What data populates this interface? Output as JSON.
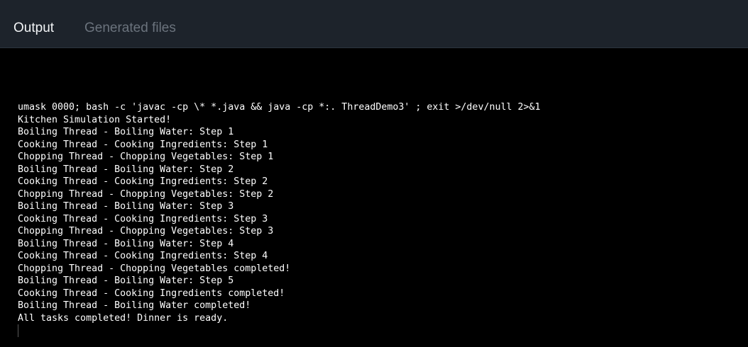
{
  "tabs": {
    "output": "Output",
    "generated_files": "Generated files"
  },
  "terminal": {
    "lines": [
      "umask 0000; bash -c 'javac -cp \\* *.java && java -cp *:. ThreadDemo3' ; exit >/dev/null 2>&1",
      "Kitchen Simulation Started!",
      "Boiling Thread - Boiling Water: Step 1",
      "Cooking Thread - Cooking Ingredients: Step 1",
      "Chopping Thread - Chopping Vegetables: Step 1",
      "Boiling Thread - Boiling Water: Step 2",
      "Cooking Thread - Cooking Ingredients: Step 2",
      "Chopping Thread - Chopping Vegetables: Step 2",
      "Boiling Thread - Boiling Water: Step 3",
      "Cooking Thread - Cooking Ingredients: Step 3",
      "Chopping Thread - Chopping Vegetables: Step 3",
      "Boiling Thread - Boiling Water: Step 4",
      "Cooking Thread - Cooking Ingredients: Step 4",
      "Chopping Thread - Chopping Vegetables completed!",
      "Boiling Thread - Boiling Water: Step 5",
      "Cooking Thread - Cooking Ingredients completed!",
      "Boiling Thread - Boiling Water completed!",
      "All tasks completed! Dinner is ready."
    ]
  },
  "colors": {
    "tabbar_background": "#1d232b",
    "terminal_background": "#000000",
    "active_tab_text": "#f2f4f6",
    "inactive_tab_text": "#6b737d",
    "terminal_text": "#ffffff"
  }
}
